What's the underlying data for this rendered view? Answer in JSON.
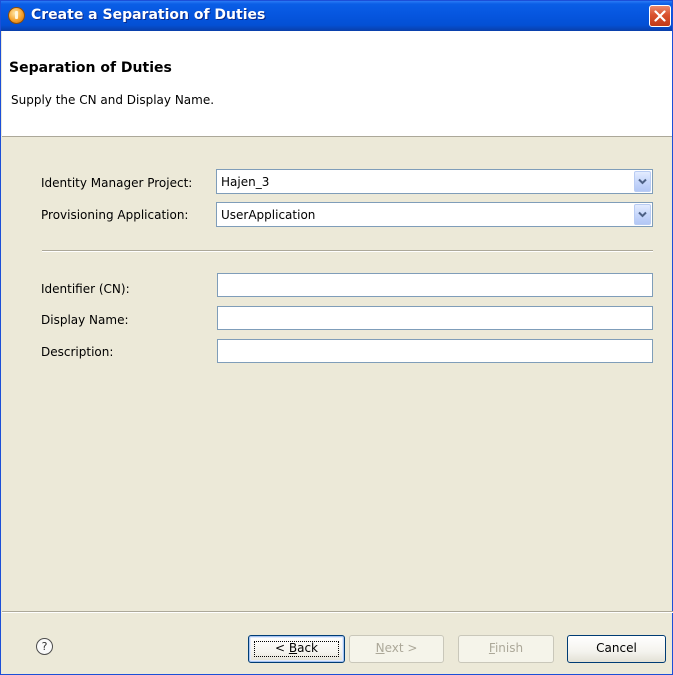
{
  "window": {
    "title": "Create a Separation of Duties"
  },
  "header": {
    "title": "Separation of Duties",
    "subtitle": "Supply the CN and Display Name."
  },
  "form": {
    "project_label": "Identity Manager Project:",
    "project_value": "Hajen_3",
    "application_label": "Provisioning Application:",
    "application_value": "UserApplication",
    "identifier_label": "Identifier (CN):",
    "identifier_value": "",
    "display_name_label": "Display Name:",
    "display_name_value": "",
    "description_label": "Description:",
    "description_value": ""
  },
  "footer": {
    "help_symbol": "?",
    "back_prefix": "< ",
    "back_mnemonic": "B",
    "back_rest": "ack",
    "next_mnemonic": "N",
    "next_rest": "ext >",
    "finish_mnemonic": "F",
    "finish_rest": "inish",
    "cancel_label": "Cancel"
  },
  "colors": {
    "titlebar_blue": "#0656df",
    "dialog_background": "#ece9d8",
    "close_red": "#d9512e",
    "input_border": "#7f9db9"
  }
}
